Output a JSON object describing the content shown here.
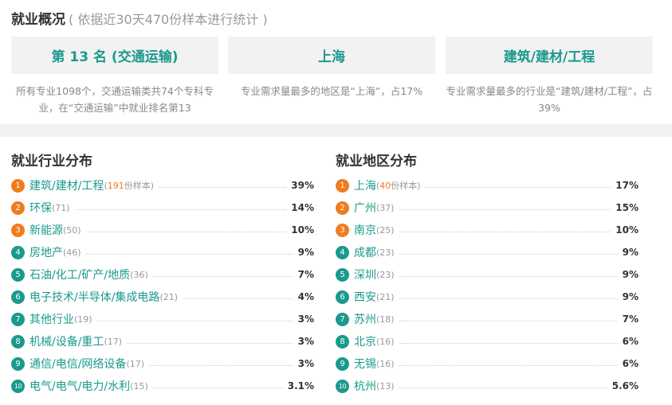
{
  "header": {
    "title": "就业概况",
    "subtitle": "( 依据近30天470份样本进行统计 )"
  },
  "cards": [
    {
      "label": "第 13 名 (交通运输)",
      "desc": "所有专业1098个，交通运输类共74个专科专业，在“交通运输”中就业排名第13"
    },
    {
      "label": "上海",
      "desc": "专业需求量最多的地区是“上海”，占17%"
    },
    {
      "label": "建筑/建材/工程",
      "desc": "专业需求量最多的行业是“建筑/建材/工程”，占39%"
    }
  ],
  "industry": {
    "title": "就业行业分布",
    "items": [
      {
        "rank": "1",
        "name": "建筑/建材/工程",
        "count_open": "(",
        "count": "191",
        "count_close": "份样本)",
        "pct": "39%"
      },
      {
        "rank": "2",
        "name": "环保",
        "count_open": "(",
        "count": "71",
        "count_close": ")",
        "pct": "14%"
      },
      {
        "rank": "3",
        "name": "新能源",
        "count_open": "(",
        "count": "50",
        "count_close": ")",
        "pct": "10%"
      },
      {
        "rank": "4",
        "name": "房地产",
        "count_open": "(",
        "count": "46",
        "count_close": ")",
        "pct": "9%"
      },
      {
        "rank": "5",
        "name": "石油/化工/矿产/地质",
        "count_open": "(",
        "count": "36",
        "count_close": ")",
        "pct": "7%"
      },
      {
        "rank": "6",
        "name": "电子技术/半导体/集成电路",
        "count_open": "(",
        "count": "21",
        "count_close": ")",
        "pct": "4%"
      },
      {
        "rank": "7",
        "name": "其他行业",
        "count_open": "(",
        "count": "19",
        "count_close": ")",
        "pct": "3%"
      },
      {
        "rank": "8",
        "name": "机械/设备/重工",
        "count_open": "(",
        "count": "17",
        "count_close": ")",
        "pct": "3%"
      },
      {
        "rank": "9",
        "name": "通信/电信/网络设备",
        "count_open": "(",
        "count": "17",
        "count_close": ")",
        "pct": "3%"
      },
      {
        "rank": "10",
        "name": "电气/电气/电力/水利",
        "count_open": "(",
        "count": "15",
        "count_close": ")",
        "pct": "3.1%"
      }
    ]
  },
  "region": {
    "title": "就业地区分布",
    "items": [
      {
        "rank": "1",
        "name": "上海",
        "count_open": "(",
        "count": "40",
        "count_close": "份样本)",
        "pct": "17%"
      },
      {
        "rank": "2",
        "name": "广州",
        "count_open": "(",
        "count": "37",
        "count_close": ")",
        "pct": "15%"
      },
      {
        "rank": "3",
        "name": "南京",
        "count_open": "(",
        "count": "25",
        "count_close": ")",
        "pct": "10%"
      },
      {
        "rank": "4",
        "name": "成都",
        "count_open": "(",
        "count": "23",
        "count_close": ")",
        "pct": "9%"
      },
      {
        "rank": "5",
        "name": "深圳",
        "count_open": "(",
        "count": "23",
        "count_close": ")",
        "pct": "9%"
      },
      {
        "rank": "6",
        "name": "西安",
        "count_open": "(",
        "count": "21",
        "count_close": ")",
        "pct": "9%"
      },
      {
        "rank": "7",
        "name": "苏州",
        "count_open": "(",
        "count": "18",
        "count_close": ")",
        "pct": "7%"
      },
      {
        "rank": "8",
        "name": "北京",
        "count_open": "(",
        "count": "16",
        "count_close": ")",
        "pct": "6%"
      },
      {
        "rank": "9",
        "name": "无锡",
        "count_open": "(",
        "count": "16",
        "count_close": ")",
        "pct": "6%"
      },
      {
        "rank": "10",
        "name": "杭州",
        "count_open": "(",
        "count": "13",
        "count_close": ")",
        "pct": "5.6%"
      }
    ]
  },
  "colors": {
    "accent": "#1a9a8c",
    "hot": "#f07c1e",
    "muted": "#999999"
  }
}
